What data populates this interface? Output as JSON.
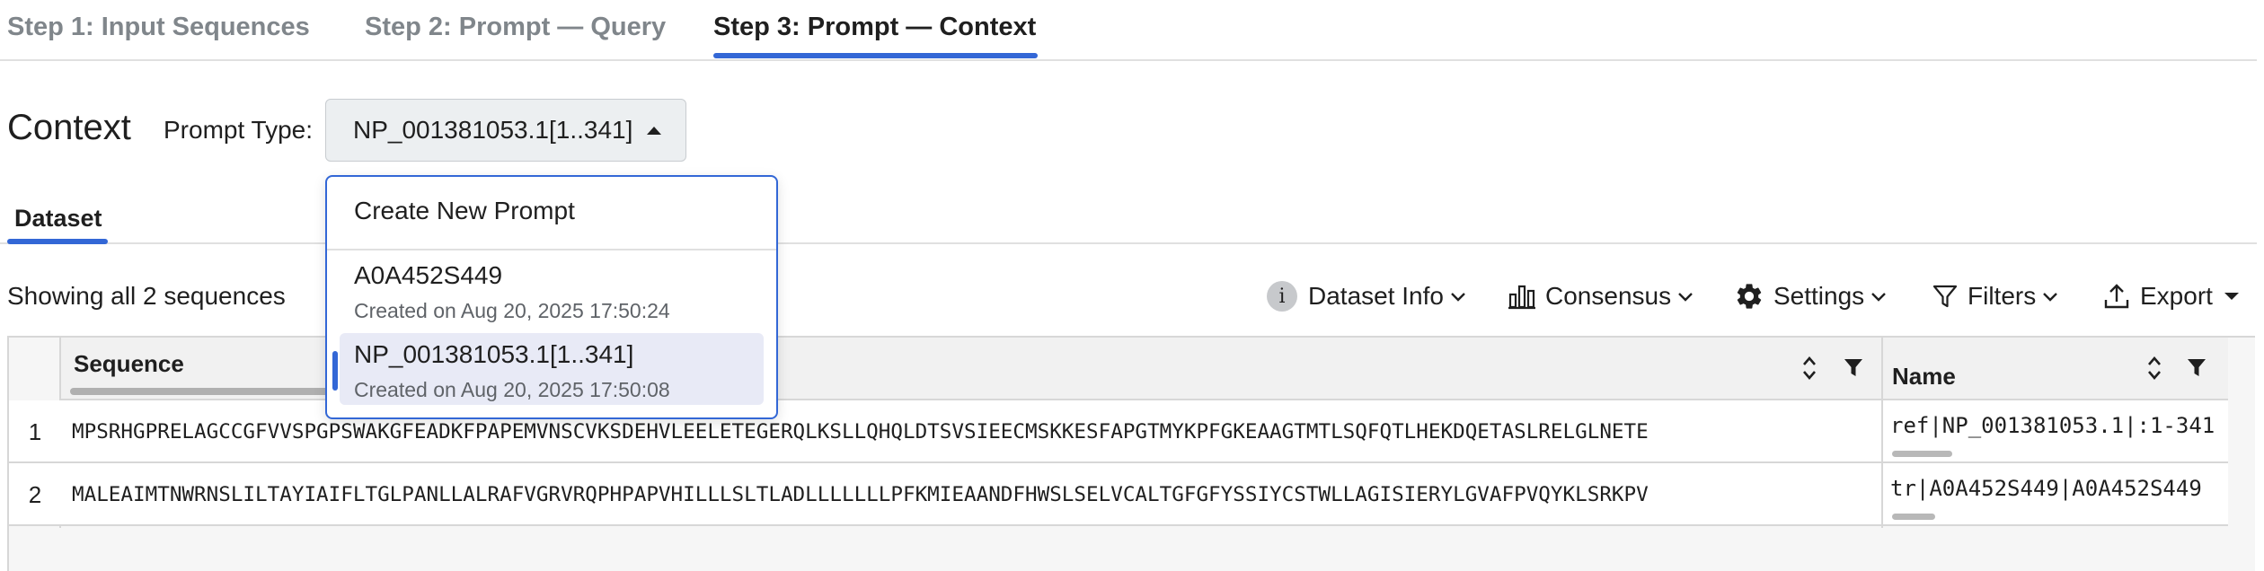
{
  "steps": [
    {
      "label": "Step 1: Input Sequences",
      "active": false
    },
    {
      "label": "Step 2: Prompt — Query",
      "active": false
    },
    {
      "label": "Step 3: Prompt — Context",
      "active": true
    }
  ],
  "context": {
    "title": "Context",
    "prompt_type_label": "Prompt Type:",
    "prompt_type_value": "NP_001381053.1[1..341]"
  },
  "dropdown": {
    "create_label": "Create New Prompt",
    "items": [
      {
        "title": "A0A452S449",
        "subtitle": "Created on Aug 20, 2025 17:50:24",
        "selected": false
      },
      {
        "title": "NP_001381053.1[1..341]",
        "subtitle": "Created on Aug 20, 2025 17:50:08",
        "selected": true
      }
    ]
  },
  "dataset_tab": {
    "label": "Dataset"
  },
  "showing_text": "Showing all 2 sequences",
  "toolbar": {
    "dataset_info": "Dataset Info",
    "consensus": "Consensus",
    "settings": "Settings",
    "filters": "Filters",
    "export": "Export"
  },
  "table": {
    "columns": [
      "Sequence",
      "Name"
    ],
    "rows": [
      {
        "num": "1",
        "sequence": "MPSRHGPRELAGCCGFVVSPGPSWAKGFEADKFPAPEMVNSCVKSDEHVLEELETEGERQLKSLLQHQLDTSVSIEECMSKKESFAPGTMYKPFGKEAAGTMTLSQFQTLHEKDQETASLRELGLNETE",
        "name": "ref|NP_001381053.1|:1-341",
        "name_scroll_fraction": 0.18
      },
      {
        "num": "2",
        "sequence": "MALEAIMTNWRNSLILTAYIAIFLTGLPANLLALRAFVGRVRQPHPAPVHILLLSLTLADLLLLLLLPFKMIEAANDFHWSLSELVCALTGFGFYSSIYCSTWLLAGISIERYLGVAFPVQYKLSRKPV",
        "name": "tr|A0A452S449|A0A452S449",
        "name_scroll_fraction": 0.13
      }
    ]
  },
  "colors": {
    "accent": "#3367d6",
    "muted": "#80868b"
  }
}
